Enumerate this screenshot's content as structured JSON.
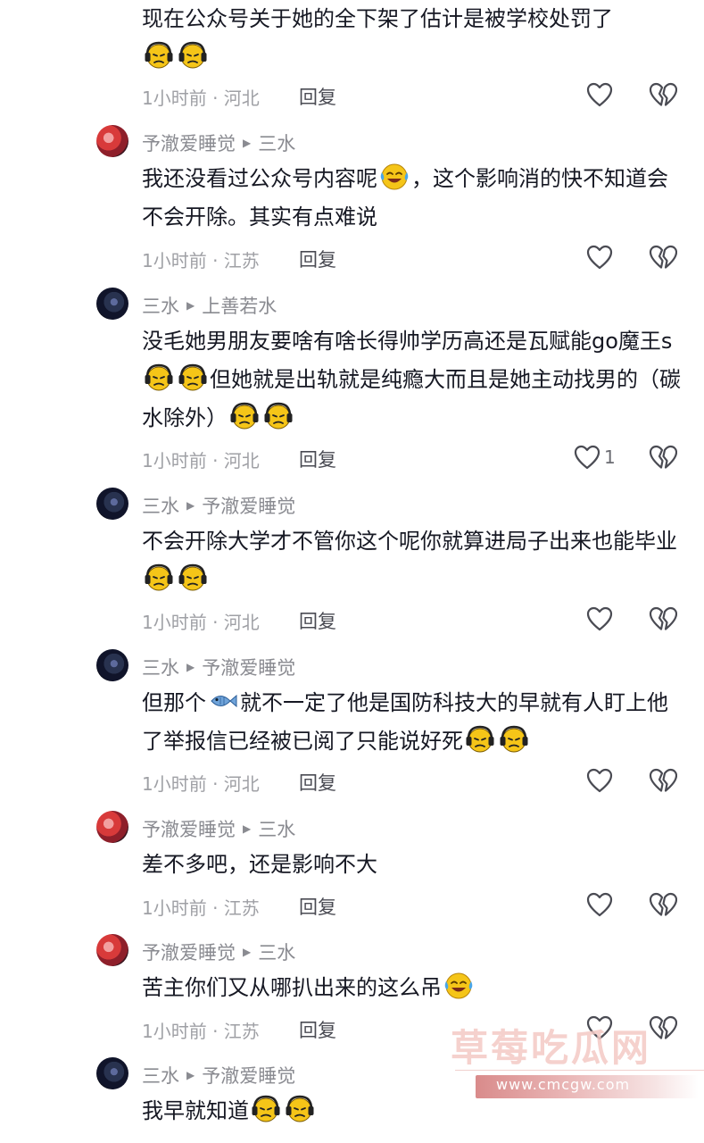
{
  "comments": [
    {
      "text": "现在公众号关于她的全下架了估计是被学校处罚了",
      "emojis_after": 2,
      "time_location": "1小时前 · 河北",
      "reply_label": "回复"
    },
    {
      "author": "予澈爱睡觉",
      "reply_to": "三水",
      "text_a": "我还没看过公众号内容呢",
      "text_b": "，这个影响消的快不知道会不会开除。其实有点难说",
      "time_location": "1小时前 · 江苏",
      "reply_label": "回复"
    },
    {
      "author": "三水",
      "reply_to": "上善若水",
      "text_a": "没毛她男朋友要啥有啥长得帅学历高还是瓦赋能go魔王s",
      "text_b": "但她就是出轨就是纯瘾大而且是她主动找男的（碳水除外）",
      "time_location": "1小时前 · 河北",
      "reply_label": "回复",
      "like_count": "1"
    },
    {
      "author": "三水",
      "reply_to": "予澈爱睡觉",
      "text": "不会开除大学才不管你这个呢你就算进局子出来也能毕业",
      "time_location": "1小时前 · 河北",
      "reply_label": "回复"
    },
    {
      "author": "三水",
      "reply_to": "予澈爱睡觉",
      "text_a": "但那个",
      "text_b": "就不一定了他是国防科技大的早就有人盯上他了举报信已经被已阅了只能说好死",
      "time_location": "1小时前 · 河北",
      "reply_label": "回复"
    },
    {
      "author": "予澈爱睡觉",
      "reply_to": "三水",
      "text": "差不多吧，还是影响不大",
      "time_location": "1小时前 · 江苏",
      "reply_label": "回复"
    },
    {
      "author": "予澈爱睡觉",
      "reply_to": "三水",
      "text": "苦主你们又从哪扒出来的这么吊",
      "time_location": "1小时前 · 江苏",
      "reply_label": "回复"
    },
    {
      "author": "三水",
      "reply_to": "予澈爱睡觉",
      "text": "我早就知道"
    }
  ],
  "watermark": {
    "title": "草莓吃瓜网",
    "url": "www.cmcgw.com"
  },
  "icons": {
    "like": "heart-outline-icon",
    "dislike": "broken-heart-icon",
    "emoji_sad": "sad-headphone-emoji",
    "emoji_cry_laugh": "tears-of-joy-emoji",
    "emoji_fish": "fish-emoji"
  },
  "colors": {
    "text": "#161823",
    "meta": "#9fa0a5",
    "emoji_yellow": "#f5c518"
  }
}
